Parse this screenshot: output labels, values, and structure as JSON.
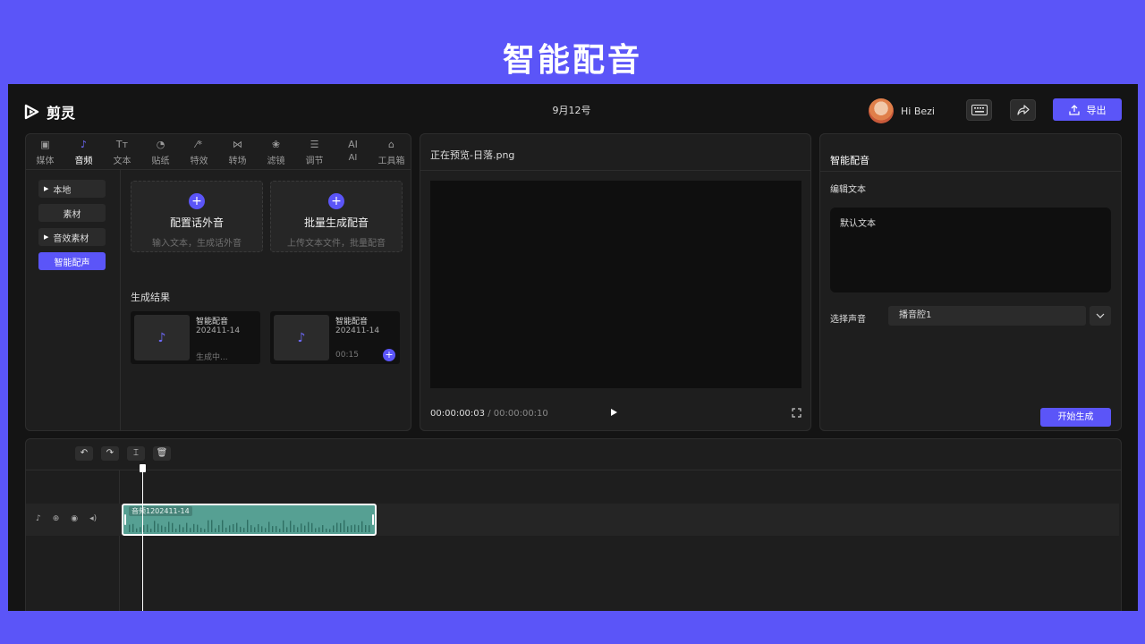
{
  "banner": {
    "title": "智能配音"
  },
  "header": {
    "app_name": "剪灵",
    "date": "9月12号",
    "user_greeting": "Hi Bezi",
    "export_label": "导出"
  },
  "tabs": [
    {
      "label": "媒体",
      "icon": "media-icon"
    },
    {
      "label": "音频",
      "icon": "music-note-icon",
      "active": true
    },
    {
      "label": "文本",
      "icon": "text-icon"
    },
    {
      "label": "贴纸",
      "icon": "sticker-icon"
    },
    {
      "label": "特效",
      "icon": "magic-wand-icon"
    },
    {
      "label": "转场",
      "icon": "transition-icon"
    },
    {
      "label": "滤镜",
      "icon": "filter-icon"
    },
    {
      "label": "调节",
      "icon": "sliders-icon"
    },
    {
      "label": "AI",
      "icon": "ai-icon"
    },
    {
      "label": "工具箱",
      "icon": "toolbox-icon"
    }
  ],
  "side_nav": [
    {
      "label": "本地",
      "expandable": true
    },
    {
      "label": "素材",
      "expandable": false
    },
    {
      "label": "音效素材",
      "expandable": true
    },
    {
      "label": "智能配声",
      "active": true
    }
  ],
  "gen_cards": [
    {
      "title": "配置话外音",
      "subtitle": "输入文本，生成话外音"
    },
    {
      "title": "批量生成配音",
      "subtitle": "上传文本文件，批量配音"
    }
  ],
  "results": {
    "heading": "生成结果",
    "items": [
      {
        "name": "智能配音",
        "date": "202411-14",
        "status": "生成中..."
      },
      {
        "name": "智能配音",
        "date": "202411-14",
        "status": "00:15"
      }
    ]
  },
  "preview": {
    "title": "正在预览-日落.png",
    "current_time": "00:00:00:03",
    "separator": "/",
    "total_time": "00:00:00:10"
  },
  "right_panel": {
    "title": "智能配音",
    "edit_label": "编辑文本",
    "text_value": "默认文本",
    "voice_label": "选择声音",
    "voice_value": "播音腔1",
    "start_label": "开始生成"
  },
  "timeline": {
    "clip_label": "音频1202411-14",
    "playhead_progress": 0.3
  },
  "colors": {
    "accent": "#5b55f8",
    "background": "#141414",
    "panel": "#1e1e1e",
    "clip": "#56a093"
  }
}
